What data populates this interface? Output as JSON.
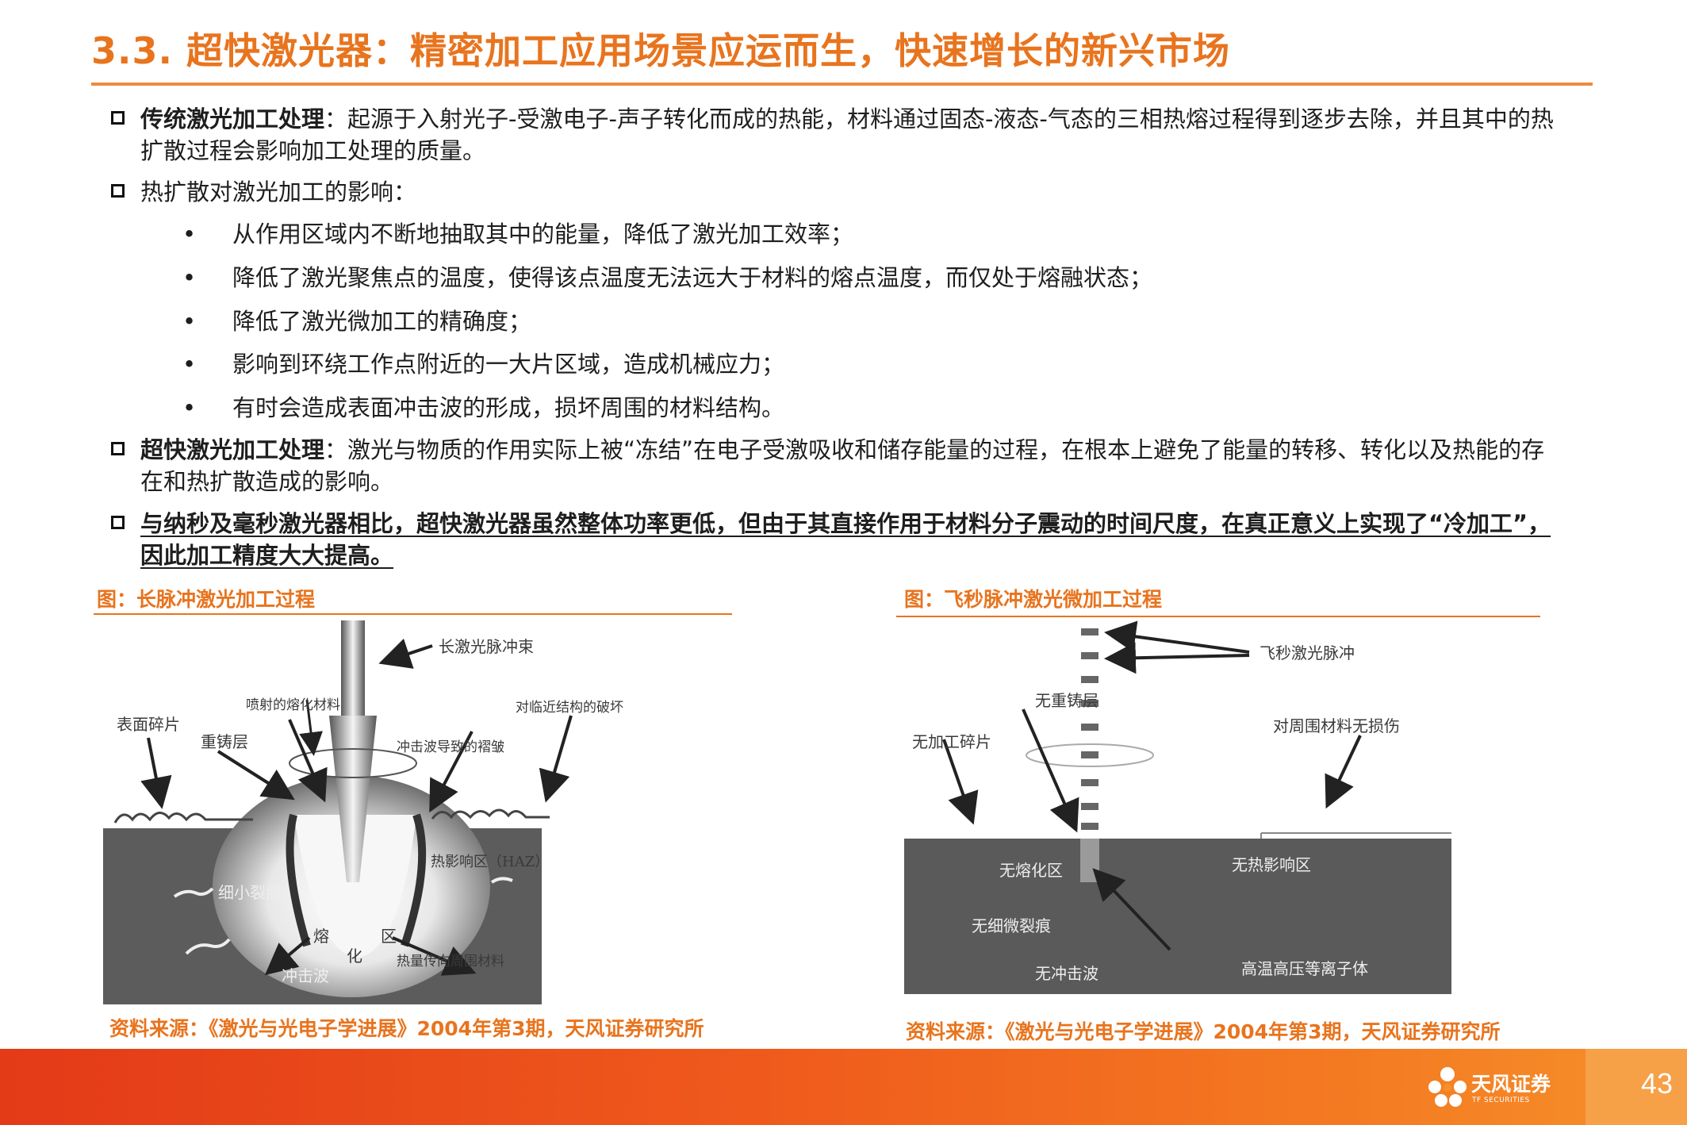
{
  "title": "3.3. 超快激光器：精密加工应用场景应运而生，快速增长的新兴市场",
  "items": [
    {
      "label": "传统激光加工处理",
      "text": "：起源于入射光子-受激电子-声子转化而成的热能，材料通过固态-液态-气态的三相热熔过程得到逐步去除，并且其中的热扩散过程会影响加工处理的质量。"
    },
    {
      "text": "热扩散对激光加工的影响："
    },
    {
      "label": "超快激光加工处理",
      "text": "：激光与物质的作用实际上被“冻结”在电子受激吸收和储存能量的过程，在根本上避免了能量的转移、转化以及热能的存在和热扩散造成的影响。"
    },
    {
      "text": "与纳秒及毫秒激光器相比，超快激光器虽然整体功率更低，但由于其直接作用于材料分子震动的时间尺度，在真正意义上实现了“冷加工”，因此加工精度大大提高。"
    }
  ],
  "bullets": [
    "从作用区域内不断地抽取其中的能量，降低了激光加工效率；",
    "降低了激光聚焦点的温度，使得该点温度无法远大于材料的熔点温度，而仅处于熔融状态；",
    "降低了激光微加工的精确度；",
    "影响到环绕工作点附近的一大片区域，造成机械应力；",
    "有时会造成表面冲击波的形成，损坏周围的材料结构。"
  ],
  "bullet_symbol": "•",
  "figure_left": {
    "title": "图：长脉冲激光加工过程",
    "source": "资料来源：《激光与光电子学进展》2004年第3期，天风证券研究所",
    "labels": {
      "beam": "长激光脉冲束",
      "debris": "表面碎片",
      "ejected": "喷射的熔化材料",
      "recast": "重铸层",
      "shock_wrinkle": "冲击波导致的褶皱",
      "damage": "对临近结构的破坏",
      "haz": "热影响区（HAZ）",
      "cracks": "细小裂痕",
      "melt1": "熔",
      "melt2": "区",
      "melt3": "化",
      "shockwave": "冲击波",
      "heat": "热量传向周围材料"
    }
  },
  "figure_right": {
    "title": "图：飞秒脉冲激光微加工过程",
    "source": "资料来源：《激光与光电子学进展》2004年第3期，天风证券研究所",
    "labels": {
      "pulse": "飞秒激光脉冲",
      "no_recast": "无重铸层",
      "no_debris": "无加工碎片",
      "no_damage": "对周围材料无损伤",
      "no_melt": "无熔化区",
      "no_haz": "无热影响区",
      "no_cracks": "无细微裂痕",
      "no_shock": "无冲击波",
      "plasma": "高温高压等离子体"
    }
  },
  "footer": {
    "page": "43",
    "logo_cn": "天风证券",
    "logo_en": "TF SECURITIES"
  },
  "colors": {
    "accent": "#e8741e",
    "footer": "#ef5a1c"
  }
}
